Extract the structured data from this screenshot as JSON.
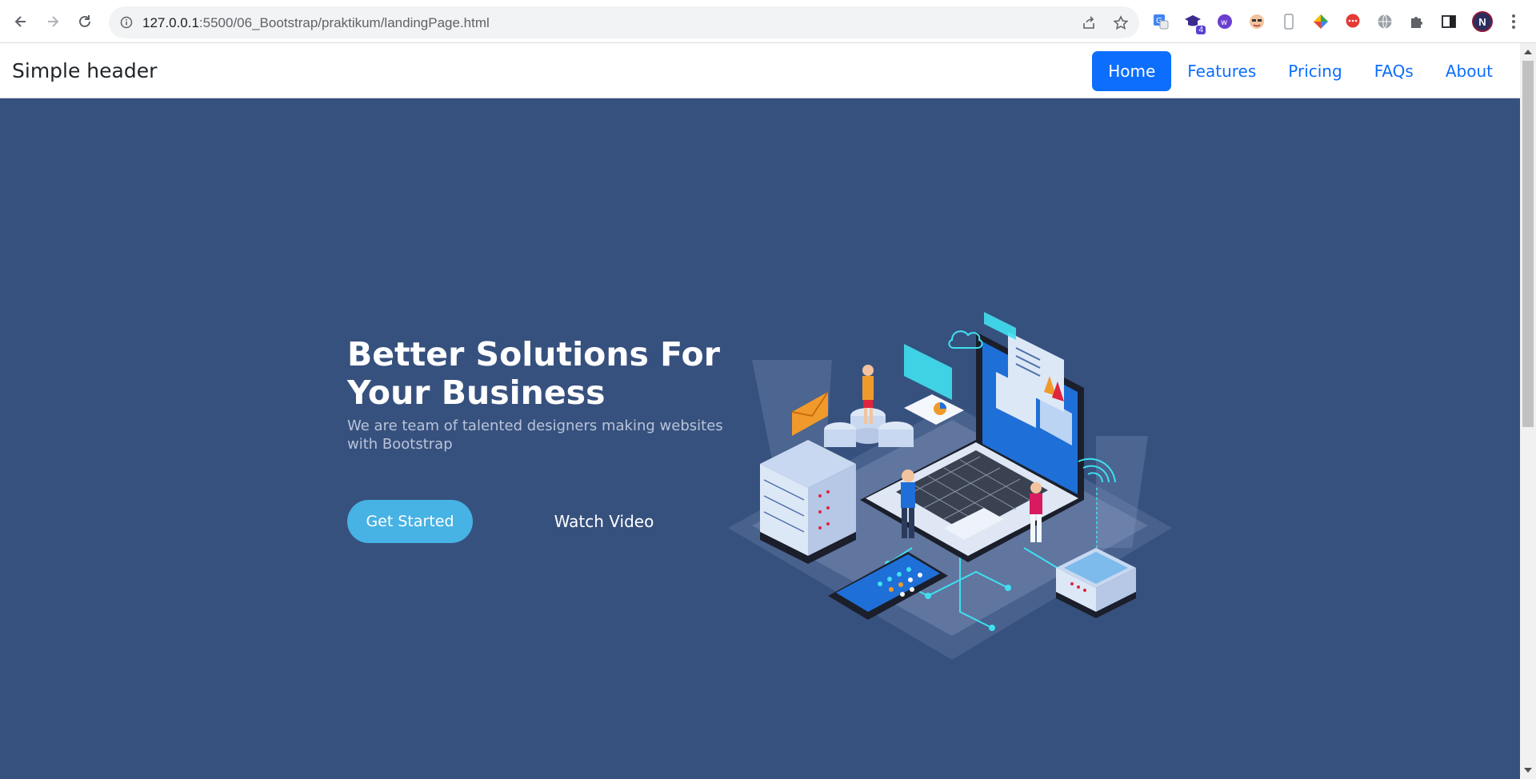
{
  "browser": {
    "url_host": "127.0.0.1",
    "url_rest": ":5500/06_Bootstrap/praktikum/landingPage.html",
    "extension_badge": "4",
    "profile_initial": "N"
  },
  "header": {
    "brand": "Simple header",
    "nav": [
      {
        "label": "Home",
        "active": true
      },
      {
        "label": "Features",
        "active": false
      },
      {
        "label": "Pricing",
        "active": false
      },
      {
        "label": "FAQs",
        "active": false
      },
      {
        "label": "About",
        "active": false
      }
    ]
  },
  "hero": {
    "title": "Better Solutions For Your Business",
    "subtitle": "We are team of talented designers making websites with Bootstrap",
    "primary_button": "Get Started",
    "secondary_button": "Watch Video",
    "illustration": "isometric-tech-illustration"
  },
  "colors": {
    "hero_bg": "#37517e",
    "primary": "#0d6efd",
    "accent": "#47b2e4"
  }
}
